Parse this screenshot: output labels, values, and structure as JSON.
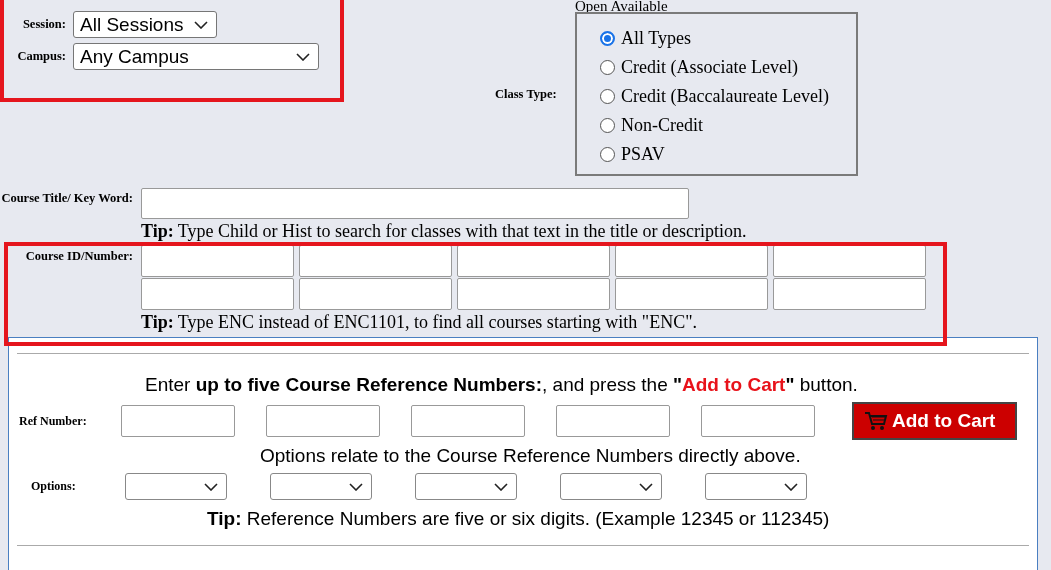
{
  "session": {
    "label": "Session:",
    "value": "All Sessions"
  },
  "campus": {
    "label": "Campus:",
    "value": "Any Campus"
  },
  "class_type": {
    "heading": "Open Available",
    "label": "Class Type:",
    "options": [
      {
        "label": "All Types",
        "selected": true
      },
      {
        "label": "Credit (Associate Level)",
        "selected": false
      },
      {
        "label": "Credit (Baccalaureate Level)",
        "selected": false
      },
      {
        "label": "Non-Credit",
        "selected": false
      },
      {
        "label": "PSAV",
        "selected": false
      }
    ]
  },
  "course_title": {
    "label": "Course Title/ Key Word:",
    "tip": "**Tip:** Type Child or Hist to search for classes with that text in the title or description."
  },
  "course_id": {
    "label": "Course ID/Number:",
    "tip": "**Tip:** Type ENC instead of ENC1101, to find all courses starting with \"ENC\"."
  },
  "reference": {
    "intro_start": "Enter **up to five Course Reference Numbers:**, and press the **\"**",
    "intro_highlight": "Add to Cart",
    "intro_end": "**\"** button.",
    "ref_label": "Ref Number:",
    "button": "Add to Cart",
    "options_note": "Options relate to the Course Reference Numbers directly above.",
    "options_label": "Options:",
    "tip": "**Tip:** Reference Numbers are five or six digits. (Example 12345 or 112345)"
  }
}
